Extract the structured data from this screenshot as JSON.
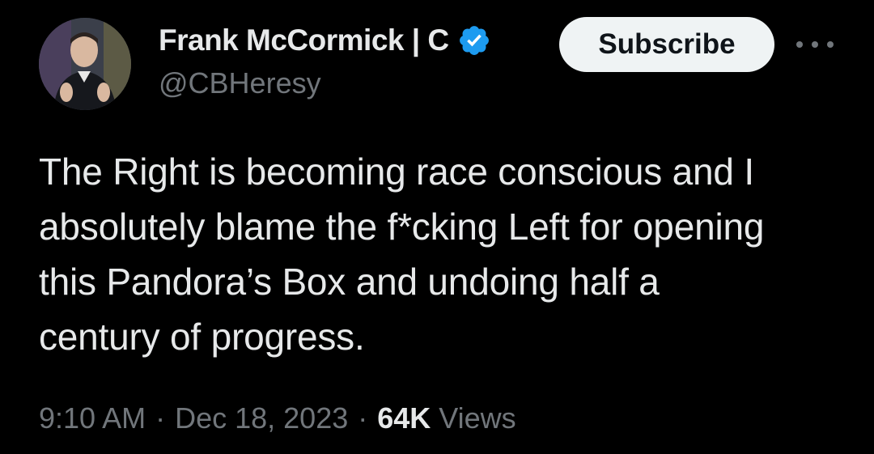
{
  "author": {
    "display_name": "Frank McCormick | C",
    "handle": "@CBHeresy",
    "verified": true
  },
  "actions": {
    "subscribe_label": "Subscribe",
    "more_icon": "more-horizontal-icon"
  },
  "tweet": {
    "text": "The Right is becoming race conscious and I\nabsolutely blame the f*cking Left for opening\nthis Pandora’s Box and undoing half a\ncentury of progress."
  },
  "meta": {
    "time": "9:10 AM",
    "separator": "·",
    "date": "Dec 18, 2023",
    "views_count": "64K",
    "views_label": "Views"
  },
  "colors": {
    "background": "#000000",
    "text_primary": "#e7e9ea",
    "text_secondary": "#71767b",
    "verified_badge": "#1d9bf0",
    "subscribe_bg": "#eff3f4"
  }
}
